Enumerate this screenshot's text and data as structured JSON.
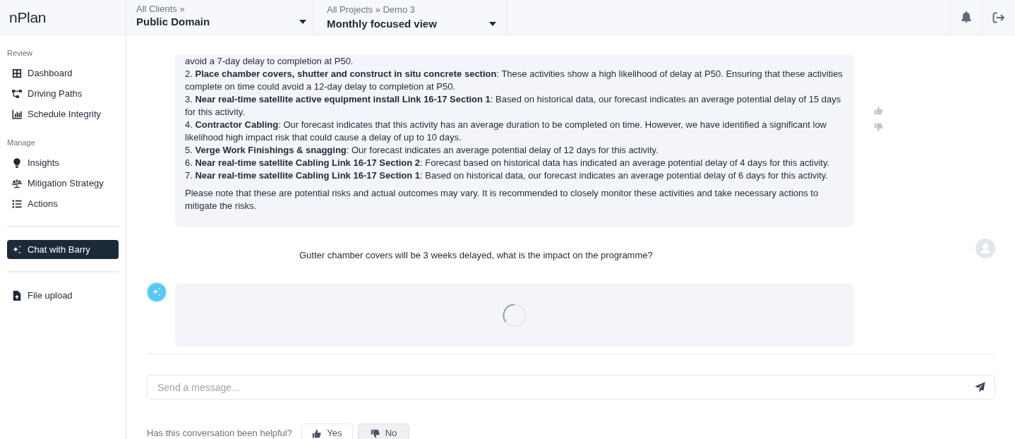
{
  "app": {
    "logo": "nPlan"
  },
  "top_bar": {
    "client_selector": {
      "breadcrumb": "All Clients »",
      "value": "Public Domain"
    },
    "project_selector": {
      "breadcrumb": "All Projects » Demo 3",
      "value": "Monthly focused view"
    }
  },
  "sidebar": {
    "sections": [
      {
        "label": "Review",
        "items": [
          {
            "label": "Dashboard",
            "selected": false
          },
          {
            "label": "Driving Paths",
            "selected": false
          },
          {
            "label": "Schedule Integrity",
            "selected": false
          }
        ]
      },
      {
        "label": "Manage",
        "items": [
          {
            "label": "Insights",
            "selected": false
          },
          {
            "label": "Mitigation Strategy",
            "selected": false
          },
          {
            "label": "Actions",
            "selected": false
          }
        ]
      },
      {
        "items": [
          {
            "label": "Chat with Barry",
            "selected": true
          }
        ]
      },
      {
        "items": [
          {
            "label": "File upload",
            "selected": false
          }
        ]
      }
    ]
  },
  "chat": {
    "messages": [
      {
        "kind": "assistant",
        "cut_off_top": true,
        "loading": false,
        "list_items": [
          "avoid a 7-day delay to completion at P50.",
          "2. **Place chamber covers, shutter and construct in situ concrete section**: These activities show a high likelihood of delay at P50. Ensuring that these activities complete on time could avoid a 12-day delay to completion at P50.",
          "3. **Near real-time satellite active equipment install Link 16-17 Section 1**: Based on historical data, our forecast indicates an average potential delay of 15 days for this activity.",
          "4. **Contractor Cabling**: Our forecast indicates that this activity has an average duration to be completed on time. However, we have identified a significant low likelihood high impact risk that could cause a delay of up to 10 days.",
          "5. **Verge Work Finishings & snagging**: Our forecast indicates an average potential delay of 12 days for this activity.",
          "6. **Near real-time satellite Cabling Link 16-17 Section 2**: Forecast based on historical data has indicated an average potential delay of 4 days for this activity.",
          "7. **Near real-time satellite Cabling Link 16-17 Section 1**: Based on historical data, our forecast indicates an average potential delay of 6 days for this activity."
        ],
        "paragraphs": [
          "Please note that these are potential risks and actual outcomes may vary. It is recommended to closely monitor these activities and take necessary actions to mitigate the risks."
        ]
      },
      {
        "kind": "user",
        "text": "Gutter chamber covers will be 3 weeks delayed, what is the impact on the programme?"
      },
      {
        "kind": "assistant",
        "cut_off_top": false,
        "loading": true
      }
    ],
    "input": {
      "placeholder": "Send a message..."
    },
    "feedback": {
      "question": "Has this conversation been helpful?",
      "options": [
        {
          "label": "Yes",
          "selected": false
        },
        {
          "label": "No",
          "selected": true
        }
      ]
    }
  }
}
